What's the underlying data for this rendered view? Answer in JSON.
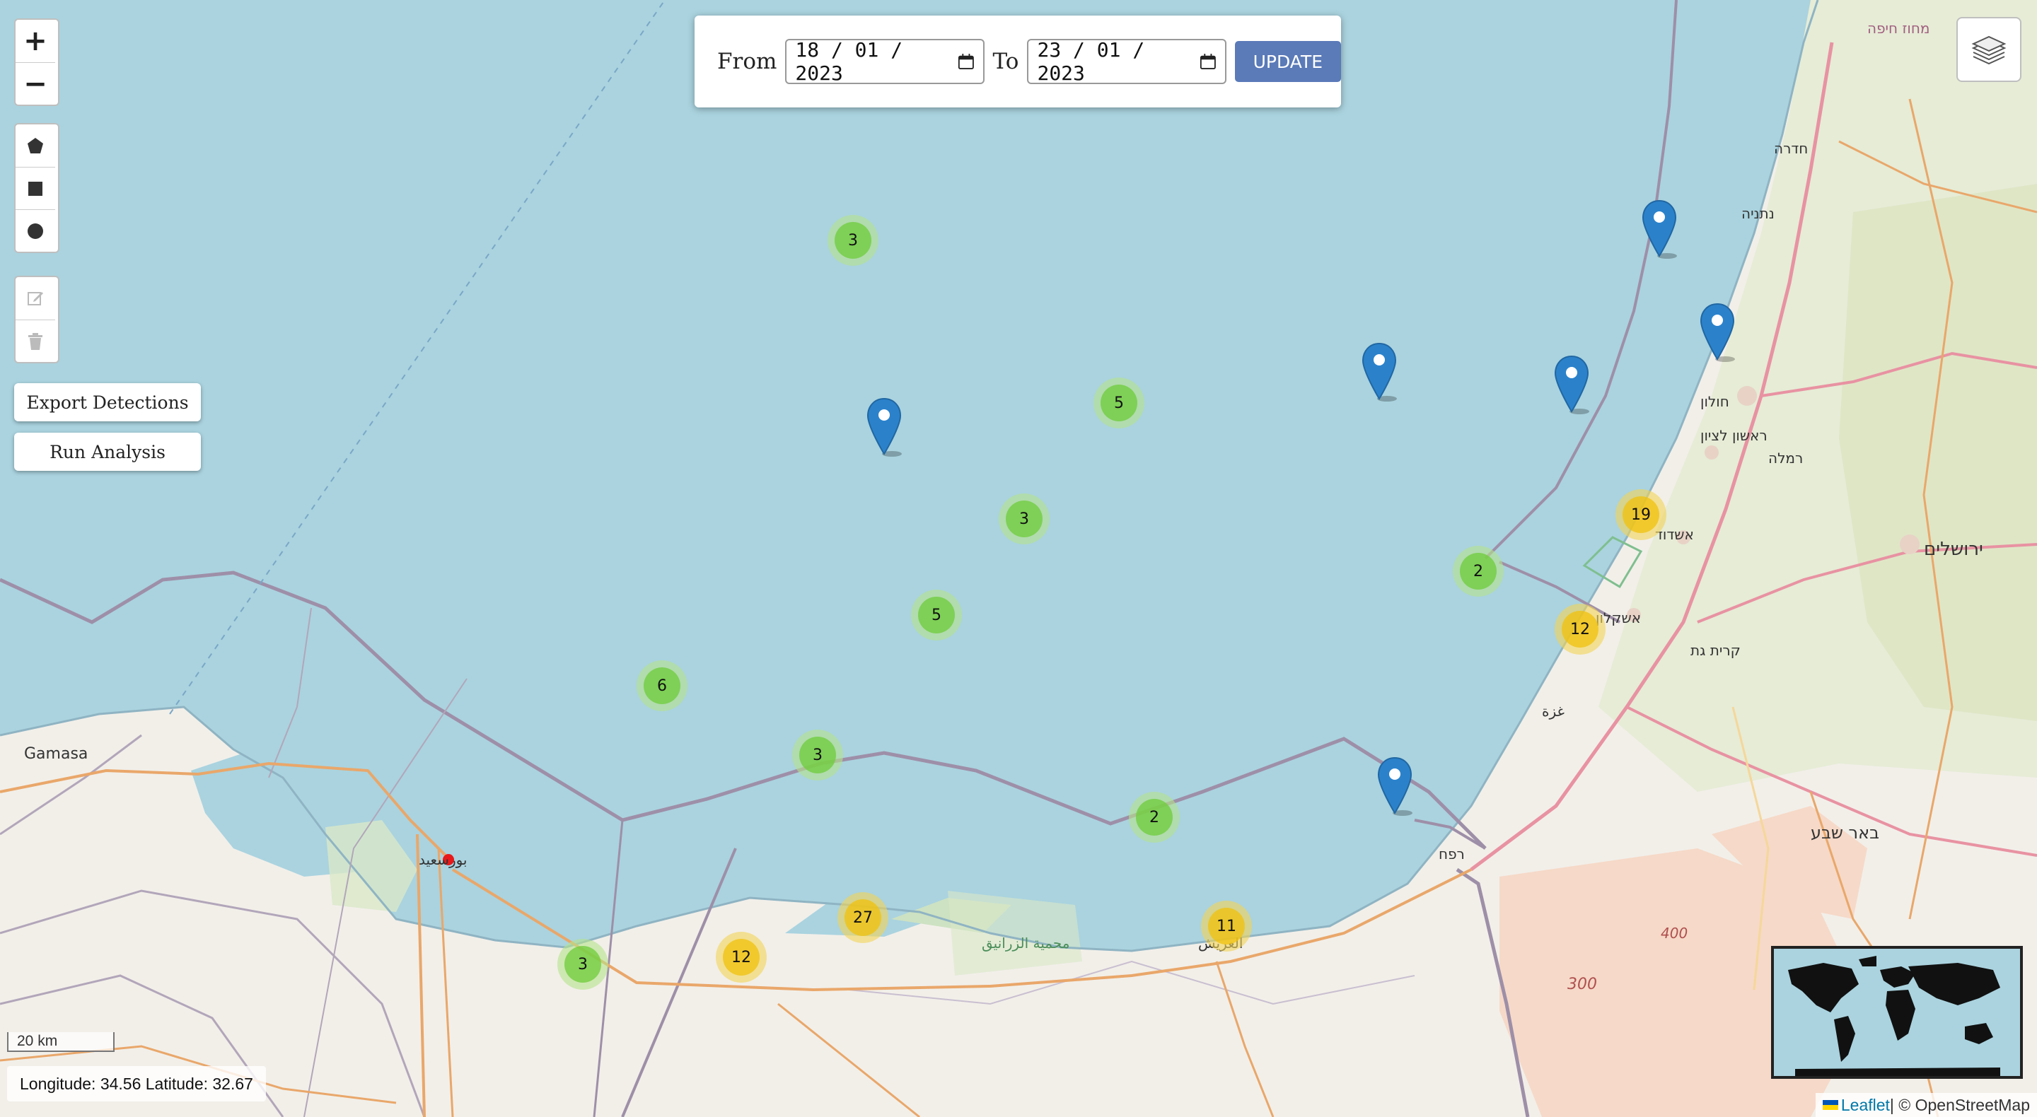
{
  "map": {
    "zoom_in_label": "+",
    "zoom_out_label": "−",
    "labels": {
      "gamasa": "Gamasa",
      "jerusalem": "ירושלים",
      "ashdod": "אשדוד",
      "ashkelon": "אשקלון",
      "gaza": "غزة",
      "rafah": "רפח",
      "beersheba": "באר שבע",
      "arish": "العريش",
      "port_said": "بورسعيد",
      "kiryat_gat": "קרית גת",
      "netanya": "נתניה",
      "hadera": "חדרה",
      "haifa": "מחוז חיפה",
      "rishon": "ראשון לציון",
      "holon": "חולון",
      "ramla": "רמלה",
      "nature_reserve": "محمية الزرانيق",
      "contour_300": "300",
      "contour_400": "400"
    },
    "clusters": [
      {
        "count": "3",
        "size": "small"
      },
      {
        "count": "5",
        "size": "small"
      },
      {
        "count": "3",
        "size": "small"
      },
      {
        "count": "5",
        "size": "small"
      },
      {
        "count": "6",
        "size": "small"
      },
      {
        "count": "3",
        "size": "small"
      },
      {
        "count": "2",
        "size": "small"
      },
      {
        "count": "2",
        "size": "small"
      },
      {
        "count": "3",
        "size": "small"
      },
      {
        "count": "12",
        "size": "medium"
      },
      {
        "count": "27",
        "size": "medium"
      },
      {
        "count": "11",
        "size": "medium"
      },
      {
        "count": "19",
        "size": "medium"
      },
      {
        "count": "12",
        "size": "medium"
      }
    ]
  },
  "toolbar": {
    "export_label": "Export Detections",
    "analysis_label": "Run Analysis"
  },
  "date_filter": {
    "from_label": "From",
    "from_value": "18 / 01 / 2023",
    "to_label": "To",
    "to_value": "23 / 01 / 2023",
    "update_label": "UPDATE"
  },
  "status": {
    "scale_label": "20 km",
    "coords_text": "Longitude: 34.56 Latitude: 32.67"
  },
  "attribution": {
    "leaflet": "Leaflet",
    "separator": " | © OpenStreetMap"
  }
}
